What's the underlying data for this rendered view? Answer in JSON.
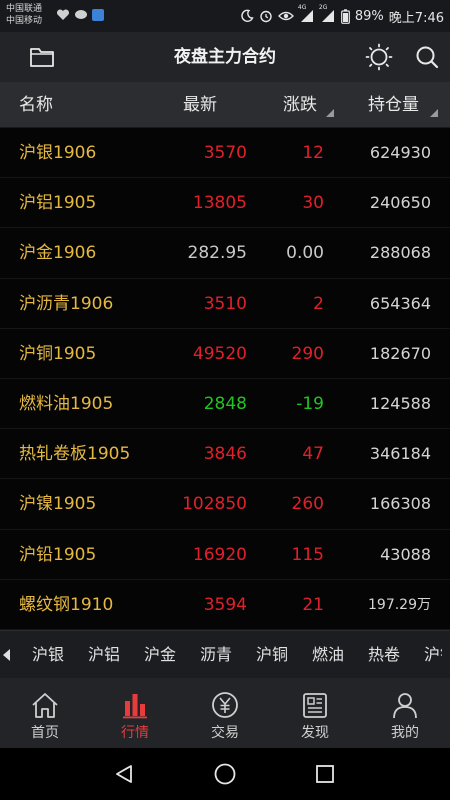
{
  "status_bar": {
    "carrier_1": "中国联通",
    "carrier_2": "中国移动",
    "network_1": "4G",
    "network_2": "2G",
    "battery": "89%",
    "time": "晚上7:46"
  },
  "header": {
    "title": "夜盘主力合约",
    "left_icon": "folder-icon",
    "right_icons": [
      "brightness-icon",
      "search-icon"
    ]
  },
  "columns": {
    "name": "名称",
    "last": "最新",
    "change": "涨跌",
    "open_interest": "持仓量"
  },
  "colors": {
    "up": "#e0202b",
    "down": "#22c422",
    "flat": "#c9c9c9",
    "name": "#e5b842",
    "active": "#e83c3c"
  },
  "rows": [
    {
      "name": "沪银1906",
      "last": "3570",
      "change": "12",
      "oi": "624930",
      "dir": "up"
    },
    {
      "name": "沪铝1905",
      "last": "13805",
      "change": "30",
      "oi": "240650",
      "dir": "up"
    },
    {
      "name": "沪金1906",
      "last": "282.95",
      "change": "0.00",
      "oi": "288068",
      "dir": "flat"
    },
    {
      "name": "沪沥青1906",
      "last": "3510",
      "change": "2",
      "oi": "654364",
      "dir": "up"
    },
    {
      "name": "沪铜1905",
      "last": "49520",
      "change": "290",
      "oi": "182670",
      "dir": "up"
    },
    {
      "name": "燃料油1905",
      "last": "2848",
      "change": "-19",
      "oi": "124588",
      "dir": "down"
    },
    {
      "name": "热轧卷板1905",
      "last": "3846",
      "change": "47",
      "oi": "346184",
      "dir": "up"
    },
    {
      "name": "沪镍1905",
      "last": "102850",
      "change": "260",
      "oi": "166308",
      "dir": "up"
    },
    {
      "name": "沪铅1905",
      "last": "16920",
      "change": "115",
      "oi": "43088",
      "dir": "up"
    },
    {
      "name": "螺纹钢1910",
      "last": "3594",
      "change": "21",
      "oi": "197.29万",
      "dir": "up"
    }
  ],
  "quick_tabs": [
    "沪银",
    "沪铝",
    "沪金",
    "沥青",
    "沪铜",
    "燃油",
    "热卷",
    "沪镍"
  ],
  "bottom_nav": [
    {
      "label": "首页",
      "icon": "home-icon",
      "active": false
    },
    {
      "label": "行情",
      "icon": "market-chart-icon",
      "active": true
    },
    {
      "label": "交易",
      "icon": "trade-yen-icon",
      "active": false
    },
    {
      "label": "发现",
      "icon": "discover-news-icon",
      "active": false
    },
    {
      "label": "我的",
      "icon": "profile-icon",
      "active": false
    }
  ],
  "system_nav": [
    "back-icon",
    "home-circle-icon",
    "recents-icon"
  ]
}
